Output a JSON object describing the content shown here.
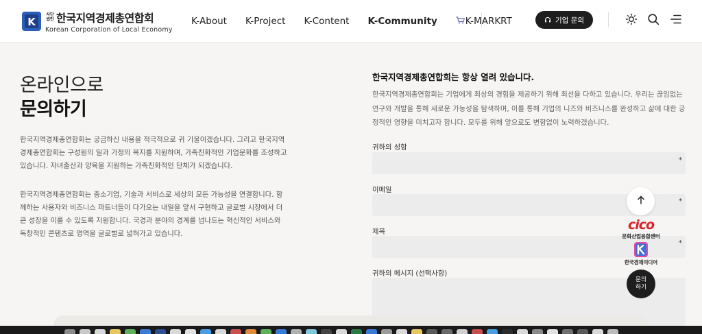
{
  "header": {
    "logo": {
      "small_line1": "사단",
      "small_line2": "법인",
      "name_ko": "한국지역경제총연합회",
      "name_en": "Korean Corporation of Local Economy",
      "mark_letter": "K"
    },
    "nav": [
      {
        "label": "K-About"
      },
      {
        "label": "K-Project"
      },
      {
        "label": "K-Content"
      },
      {
        "label": "K-Community",
        "active": true
      },
      {
        "label": "K-MARKRT",
        "icon": "cart-icon"
      }
    ],
    "inquiry_button": "기업 문의",
    "icons": [
      "sun-icon",
      "search-icon",
      "menu-icon"
    ]
  },
  "left": {
    "title_line1": "온라인으로",
    "title_line2": "문의하기",
    "para1": "한국지역경제총연합회는 궁금하신 내용을 적극적으로 귀 기울이겠습니다. 그리고 한국지역경제총연합회는 구성원의 일과 가정의 복지를 지원하며, 가족친화적인 기업문화를 조성하고 있습니다. 자녀출산과 양육을 지원하는 가족친화적인 단체가 되겠습니다.",
    "para2": "한국지역경제총연합회는 중소기업, 기술과 서비스로 세상의 모든 가능성을 연결합니다. 함께하는 사용자와 비즈니스 파트너들이 다가오는 내일을 앞서 구현하고 글로벌 시장에서 더 큰 성장을 이룰 수 있도록 지원합니다. 국경과 분야의 경계를 넘나드는 혁신적인 서비스와 독창적인 콘텐츠로 영역을 글로벌로 넓혀가고 있습니다."
  },
  "right": {
    "heading": "한국지역경제총연합회는 항상 열려 있습니다.",
    "para": "한국지역경제총연합회는 기업에게 최상의 경험을 제공하기 위해 최선을 다하고 있습니다. 우리는 끊임없는 연구와 개발을 통해 새로운 가능성을 탐색하며, 이를 통해 기업의 니즈와 비즈니스를 완성하고 삶에 대한 긍정적인 영향을 미치고자 합니다. 모두를 위해 앞으로도 변함없이 노력하겠습니다.",
    "form": {
      "name_label": "귀하의 성함",
      "email_label": "이메일",
      "subject_label": "제목",
      "message_label": "귀하의 메시지 (선택사항)",
      "required_mark": "*"
    }
  },
  "floating": {
    "cico_logo": "cico",
    "cico_label": "문화산업융합센터",
    "kem_label": "한국경제미디어",
    "inquiry_line1": "문의",
    "inquiry_line2": "하기"
  },
  "dock": {
    "icon_colors": [
      "#8a8a8a",
      "#c9c9c9",
      "#d8d8d8",
      "#e6c860",
      "#5fb15a",
      "#3a7bd5",
      "#2b4f8f",
      "#d9d9d9",
      "#e2e2e2",
      "#4a9de0",
      "#d9d9d9",
      "#c94f4f",
      "#e08a3a",
      "#5fb15a",
      "#3a7bd5",
      "#b0b0b0",
      "#7fc7d9",
      "#444444",
      "#d9d9d9",
      "#2a7a4a",
      "#3a7bd5",
      "#9a9a9a",
      "#d9d9d9",
      "#e6c860",
      "#5a5a5a",
      "#6a6a6a",
      "#cfcfcf",
      "#c94f4f",
      "#4a9de0",
      "#2b2b2b",
      "#d9d9d9",
      "#8a8a8a",
      "#e2e2e2",
      "#707070",
      "#5a5a5a",
      "#d9d9d9",
      "#bcbcbc"
    ]
  }
}
